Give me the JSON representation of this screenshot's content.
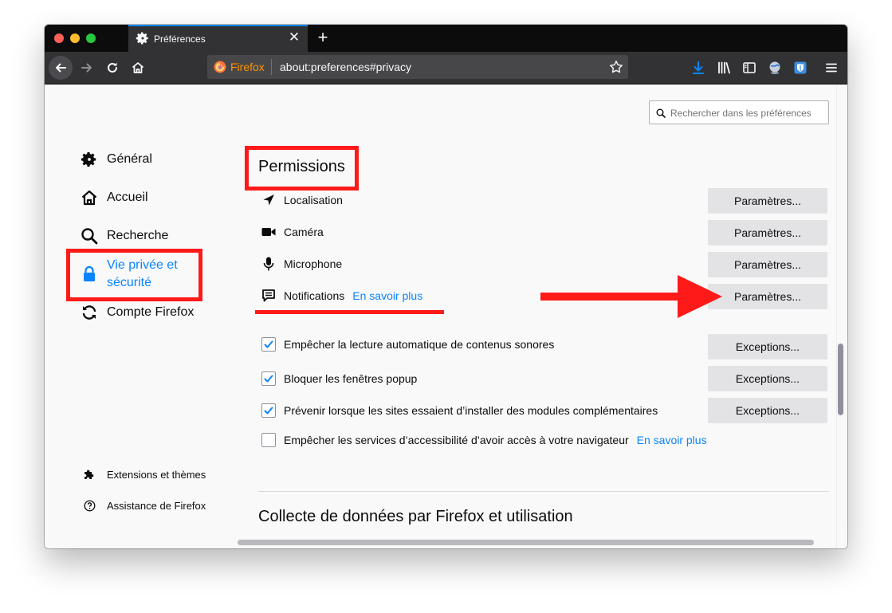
{
  "tab": {
    "title": "Préférences",
    "close_glyph": "✕"
  },
  "newtab_glyph": "+",
  "urlbar": {
    "identity_label": "Firefox",
    "url": "about:preferences#privacy"
  },
  "search": {
    "placeholder": "Rechercher dans les préférences"
  },
  "sidebar": {
    "categories": [
      {
        "label": "Général",
        "icon": "gear-icon"
      },
      {
        "label": "Accueil",
        "icon": "home-icon"
      },
      {
        "label": "Recherche",
        "icon": "search-icon"
      },
      {
        "label_line1": "Vie privée et",
        "label_line2": "sécurité",
        "icon": "lock-icon",
        "selected": true
      },
      {
        "label": "Compte Firefox",
        "icon": "sync-icon"
      }
    ],
    "footer": [
      {
        "label": "Extensions et thèmes",
        "icon": "puzzle-icon"
      },
      {
        "label": "Assistance de Firefox",
        "icon": "help-icon"
      }
    ]
  },
  "permissions": {
    "title": "Permissions",
    "rows": [
      {
        "label": "Localisation",
        "icon": "location-icon",
        "button": "Paramètres..."
      },
      {
        "label": "Caméra",
        "icon": "camera-icon",
        "button": "Paramètres..."
      },
      {
        "label": "Microphone",
        "icon": "microphone-icon",
        "button": "Paramètres..."
      },
      {
        "label": "Notifications",
        "icon": "notification-icon",
        "link": "En savoir plus",
        "button": "Paramètres..."
      }
    ],
    "checkboxes": [
      {
        "label": "Empêcher la lecture automatique de contenus sonores",
        "checked": true,
        "button": "Exceptions..."
      },
      {
        "label": "Bloquer les fenêtres popup",
        "checked": true,
        "button": "Exceptions..."
      },
      {
        "label": "Prévenir lorsque les sites essaient d’installer des modules complémentaires",
        "checked": true,
        "button": "Exceptions..."
      },
      {
        "label": "Empêcher les services d’accessibilité d’avoir accès à votre navigateur",
        "checked": false,
        "link": "En savoir plus"
      }
    ]
  },
  "next_section": {
    "title": "Collecte de données par Firefox et utilisation"
  },
  "colors": {
    "accent": "#0a84ff",
    "annotation": "#ff1a1a",
    "toolbar": "#323234",
    "tabstrip": "#0c0c0d"
  }
}
